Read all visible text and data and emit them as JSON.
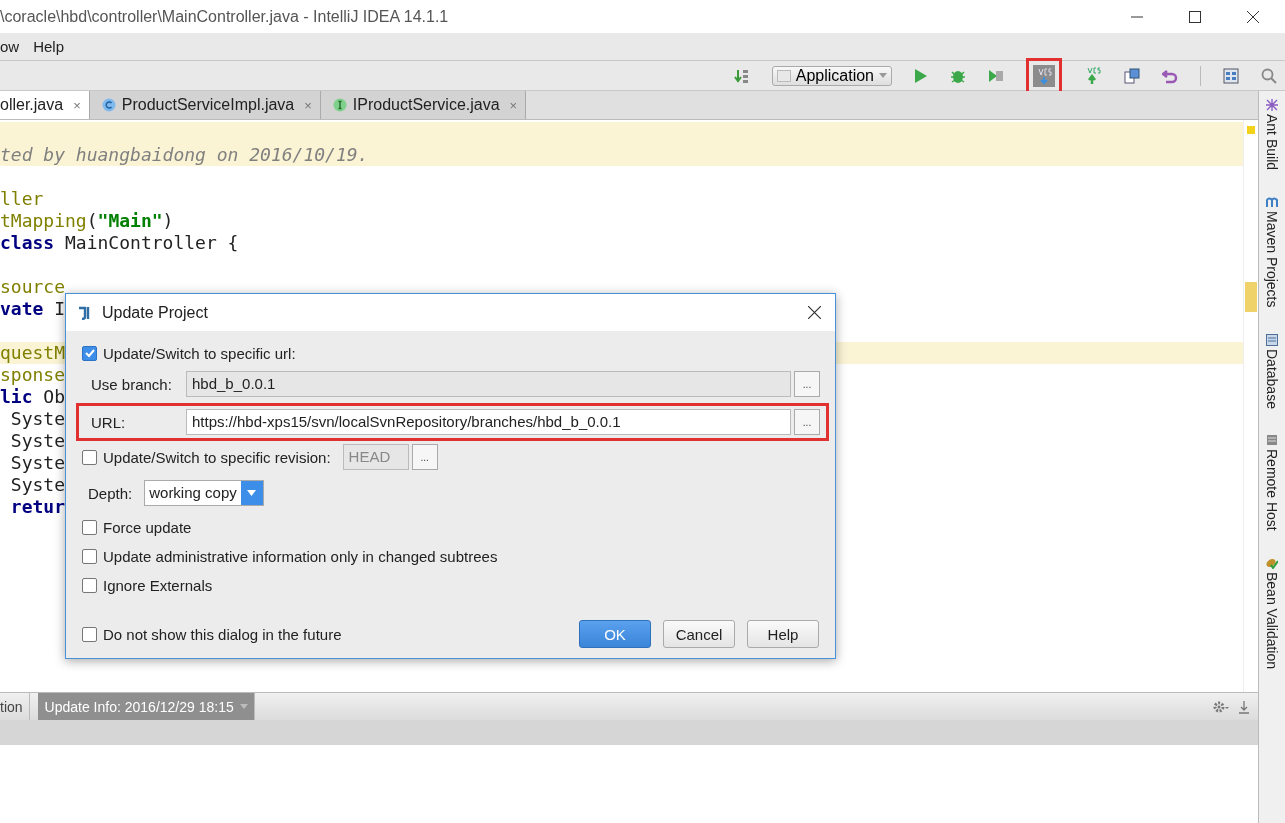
{
  "window": {
    "title": "\\coracle\\hbd\\controller\\MainController.java - IntelliJ IDEA 14.1.1"
  },
  "menu": [
    "ow",
    "Help"
  ],
  "toolbar": {
    "run_config": "Application",
    "items": [
      {
        "kind": "sort",
        "highlighted": false
      },
      {
        "kind": "config",
        "highlighted": false
      },
      {
        "kind": "run",
        "highlighted": false
      },
      {
        "kind": "debug",
        "highlighted": false
      },
      {
        "kind": "coverage",
        "highlighted": false
      },
      {
        "kind": "vcs-update",
        "highlighted": true
      },
      {
        "kind": "vcs-commit",
        "highlighted": false
      },
      {
        "kind": "compare",
        "highlighted": false
      },
      {
        "kind": "revert",
        "highlighted": false
      },
      {
        "kind": "structure",
        "highlighted": false
      },
      {
        "kind": "search",
        "highlighted": false
      }
    ]
  },
  "tabs": [
    {
      "label": "oller.java",
      "kind": "plain",
      "selected": true,
      "close": "×"
    },
    {
      "label": "ProductServiceImpl.java",
      "kind": "class",
      "selected": false,
      "close": "×"
    },
    {
      "label": "IProductService.java",
      "kind": "interface",
      "selected": false,
      "close": "×"
    }
  ],
  "editor": {
    "lines": [
      {
        "highlighted": true
      },
      {
        "highlighted": true,
        "tokens": [
          {
            "kind": "comment",
            "text": "ted by huangbaidong on 2016/10/19."
          }
        ]
      },
      {
        "highlighted": false
      },
      {
        "highlighted": false,
        "tokens": [
          {
            "kind": "annotation",
            "text": "ller"
          }
        ]
      },
      {
        "highlighted": false,
        "tokens": [
          {
            "kind": "annotation",
            "text": "tMapping"
          },
          {
            "kind": "plain",
            "text": "("
          },
          {
            "kind": "string",
            "text": "\"Main\""
          },
          {
            "kind": "plain",
            "text": ")"
          }
        ]
      },
      {
        "highlighted": false,
        "tokens": [
          {
            "kind": "keyword",
            "text": "class"
          },
          {
            "kind": "plain",
            "text": " MainController {"
          }
        ]
      },
      {
        "highlighted": false
      },
      {
        "highlighted": false,
        "tokens": [
          {
            "kind": "annotation",
            "text": "source"
          }
        ]
      },
      {
        "highlighted": false,
        "tokens": [
          {
            "kind": "keyword",
            "text": "vate"
          },
          {
            "kind": "plain",
            "text": " I"
          }
        ]
      },
      {
        "highlighted": false
      },
      {
        "highlighted": true,
        "tokens": [
          {
            "kind": "annotation",
            "text": "questM"
          }
        ]
      },
      {
        "highlighted": false,
        "tokens": [
          {
            "kind": "annotation",
            "text": "sponse"
          }
        ]
      },
      {
        "highlighted": false,
        "tokens": [
          {
            "kind": "keyword",
            "text": "lic"
          },
          {
            "kind": "plain",
            "text": " Ob"
          }
        ]
      },
      {
        "highlighted": false,
        "tokens": [
          {
            "kind": "plain",
            "text": " Syste"
          }
        ]
      },
      {
        "highlighted": false,
        "tokens": [
          {
            "kind": "plain",
            "text": " Syste"
          }
        ]
      },
      {
        "highlighted": false,
        "tokens": [
          {
            "kind": "plain",
            "text": " Syste"
          }
        ]
      },
      {
        "highlighted": false,
        "tokens": [
          {
            "kind": "plain",
            "text": " Syste"
          }
        ]
      },
      {
        "highlighted": false,
        "tokens": [
          {
            "kind": "keyword",
            "text": " retur"
          }
        ]
      }
    ]
  },
  "tool_windows": [
    {
      "label": "Ant Build",
      "kind": "ant"
    },
    {
      "label": "Maven Projects",
      "kind": "maven"
    },
    {
      "label": "Database",
      "kind": "database"
    },
    {
      "label": "Remote Host",
      "kind": "remote"
    },
    {
      "label": "Bean Validation",
      "kind": "bean"
    }
  ],
  "bottom_bar": {
    "tabs": [
      {
        "label": "tion",
        "selected": false
      },
      {
        "label": "Update Info: 2016/12/29 18:15",
        "selected": true
      }
    ]
  },
  "dialog": {
    "title": "Update Project",
    "switch_url": {
      "label": "Update/Switch to specific url:",
      "checked": true
    },
    "branch": {
      "label": "Use branch:",
      "value": "hbd_b_0.0.1",
      "button": "...",
      "highlighted": false
    },
    "url": {
      "label": "URL:",
      "value": "https://hbd-xps15/svn/localSvnRepository/branches/hbd_b_0.0.1",
      "button": "...",
      "highlighted": true
    },
    "switch_revision": {
      "label": "Update/Switch to specific revision:",
      "checked": false,
      "value": "HEAD",
      "button": "..."
    },
    "depth": {
      "label": "Depth:",
      "value": "working copy"
    },
    "options": [
      {
        "label": "Force update",
        "checked": false
      },
      {
        "label": "Update administrative information only in changed subtrees",
        "checked": false
      },
      {
        "label": "Ignore Externals",
        "checked": false
      }
    ],
    "dont_show": {
      "label": "Do not show this dialog in the future",
      "checked": false
    },
    "buttons": [
      {
        "label": "OK",
        "primary": true
      },
      {
        "label": "Cancel",
        "primary": false
      },
      {
        "label": "Help",
        "primary": false
      }
    ]
  }
}
